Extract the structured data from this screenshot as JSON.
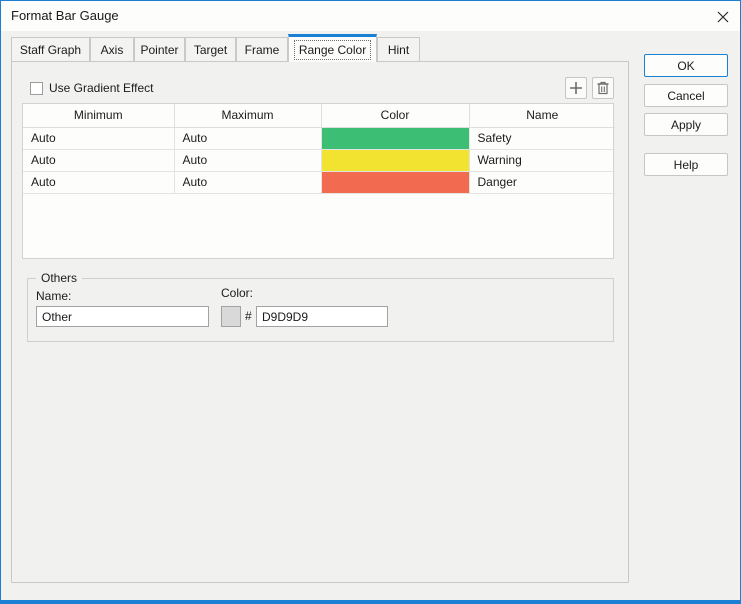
{
  "window": {
    "title": "Format Bar Gauge",
    "close_icon": "close-icon"
  },
  "tabs": [
    {
      "label": "Staff Graph"
    },
    {
      "label": "Axis"
    },
    {
      "label": "Pointer"
    },
    {
      "label": "Target"
    },
    {
      "label": "Frame"
    },
    {
      "label": "Range Color"
    },
    {
      "label": "Hint"
    }
  ],
  "panel": {
    "gradient_checkbox": {
      "label": "Use Gradient Effect",
      "checked": false
    },
    "toolbar": {
      "add_icon": "plus-icon",
      "delete_icon": "trash-icon"
    },
    "table": {
      "columns": [
        "Minimum",
        "Maximum",
        "Color",
        "Name"
      ],
      "rows": [
        {
          "minimum": "Auto",
          "maximum": "Auto",
          "color": "#3cbe74",
          "name": "Safety"
        },
        {
          "minimum": "Auto",
          "maximum": "Auto",
          "color": "#f2e330",
          "name": "Warning"
        },
        {
          "minimum": "Auto",
          "maximum": "Auto",
          "color": "#f26a50",
          "name": "Danger"
        }
      ]
    },
    "others": {
      "legend": "Others",
      "name_label": "Name:",
      "name_value": "Other",
      "color_label": "Color:",
      "swatch_color": "#d9d9d9",
      "hash": "#",
      "hex_value": "D9D9D9"
    }
  },
  "buttons": {
    "ok": "OK",
    "cancel": "Cancel",
    "apply": "Apply",
    "help": "Help"
  },
  "colors": {
    "accent_blue": "#1a80d4",
    "dialog_bg": "#f1f2ef"
  }
}
